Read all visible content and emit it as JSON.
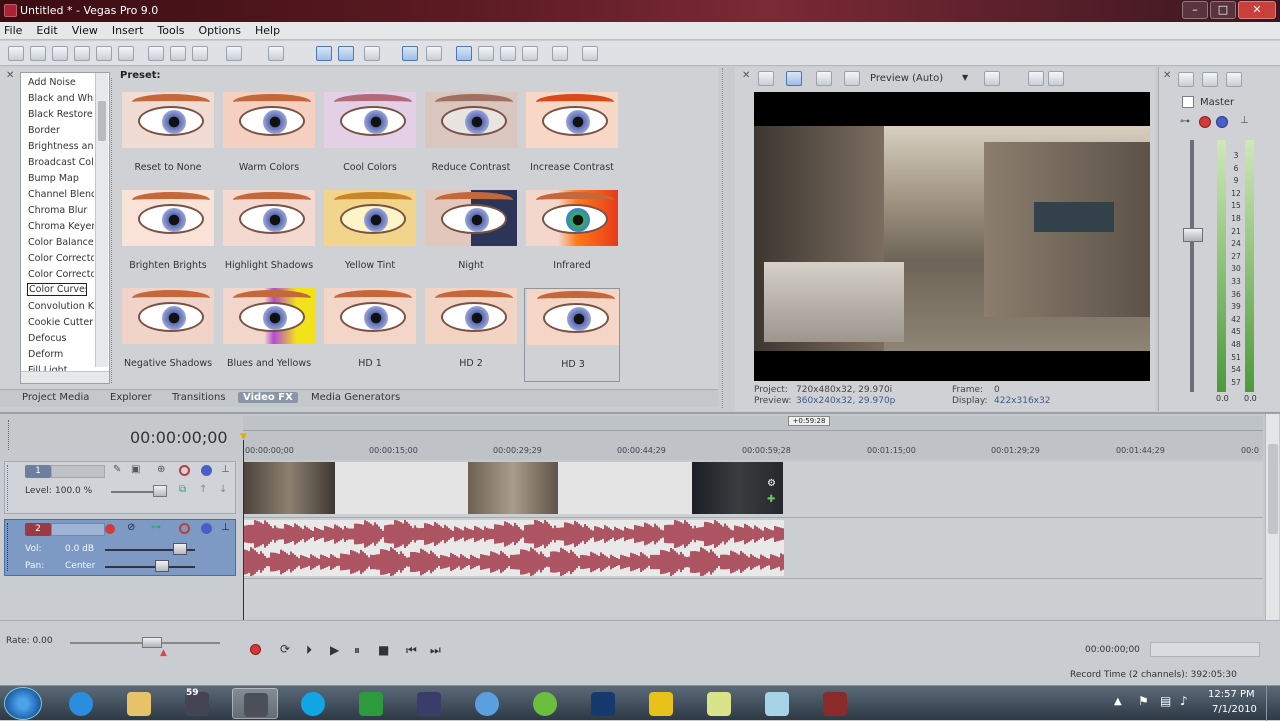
{
  "window": {
    "title": "Untitled * - Vegas Pro 9.0"
  },
  "menu": [
    "File",
    "Edit",
    "View",
    "Insert",
    "Tools",
    "Options",
    "Help"
  ],
  "fx_list": [
    "Add Noise",
    "Black and White",
    "Black Restore",
    "Border",
    "Brightness and Contrast",
    "Broadcast Colors",
    "Bump Map",
    "Channel Blend",
    "Chroma Blur",
    "Chroma Keyer",
    "Color Balance",
    "Color Corrector",
    "Color Corrector (Secondary)",
    "Color Curves",
    "Convolution Kernel",
    "Cookie Cutter",
    "Defocus",
    "Deform",
    "Fill Light"
  ],
  "fx_selected": "Color Curves",
  "preset_label": "Preset:",
  "presets": [
    "Reset to None",
    "Warm Colors",
    "Cool Colors",
    "Reduce Contrast",
    "Increase Contrast",
    "Brighten Brights",
    "Highlight Shadows",
    "Yellow Tint",
    "Night",
    "Infrared",
    "Negative Shadows",
    "Blues and Yellows",
    "HD 1",
    "HD 2",
    "HD 3"
  ],
  "tabs": [
    "Project Media",
    "Explorer",
    "Transitions",
    "Video FX",
    "Media Generators"
  ],
  "active_tab": "Video FX",
  "preview": {
    "mode": "Preview (Auto)",
    "project_label": "Project:",
    "project_value": "720x480x32, 29.970i",
    "preview_label": "Preview:",
    "preview_value": "360x240x32, 29.970p",
    "frame_label": "Frame:",
    "frame_value": "0",
    "display_label": "Display:",
    "display_value": "422x316x32"
  },
  "master": {
    "label": "Master",
    "meter_scale": [
      "3",
      "6",
      "9",
      "12",
      "15",
      "18",
      "21",
      "24",
      "27",
      "30",
      "33",
      "36",
      "39",
      "42",
      "45",
      "48",
      "51",
      "54",
      "57"
    ],
    "left_value": "0.0",
    "right_value": "0.0"
  },
  "timeline": {
    "timecode": "00:00:00;00",
    "ruler": [
      "00:00:00;00",
      "00:00:15;00",
      "00:00:29;29",
      "00:00:44;29",
      "00:00:59;28",
      "00:01:15;00",
      "00:01:29;29",
      "00:01:44;29",
      "00:0"
    ],
    "marker": "+0:59:28",
    "video_track": {
      "number": "1",
      "level_label": "Level:",
      "level_value": "100.0 %"
    },
    "audio_track": {
      "number": "2",
      "vol_label": "Vol:",
      "vol_value": "0.0 dB",
      "pan_label": "Pan:",
      "pan_value": "Center"
    }
  },
  "transport": {
    "rate": "Rate: 0.00",
    "end_time": "00:00:00;00",
    "record_time": "Record Time (2 channels): 392:05:30"
  },
  "taskbar": {
    "time": "12:57 PM",
    "date": "7/1/2010",
    "badge": "59",
    "apps": [
      "start",
      "ie",
      "explorer",
      "media",
      "vegas",
      "skype",
      "camtasia",
      "aftereffects",
      "messenger",
      "xbox",
      "photoshop",
      "aim",
      "sticky",
      "notepad",
      "screen"
    ]
  },
  "colors": {
    "accent": "#9c3a44",
    "selection": "#3b5e91",
    "audio": "#9e3040"
  }
}
